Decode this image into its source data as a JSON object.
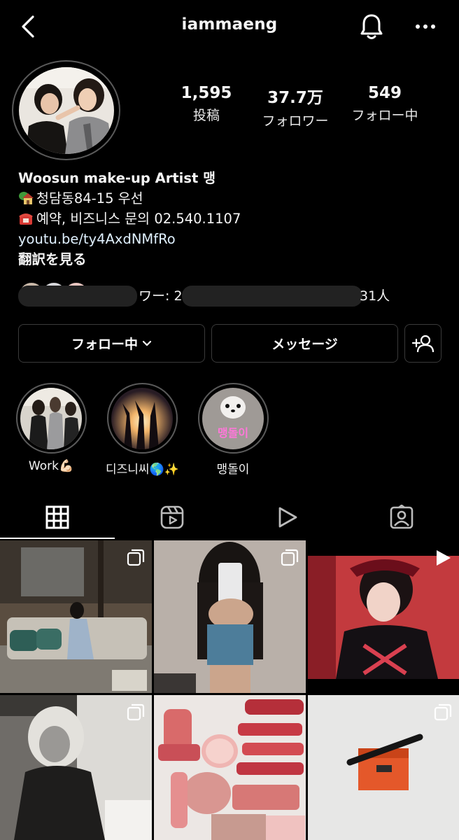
{
  "header": {
    "username": "iammaeng",
    "back_icon": "chevron-left-icon",
    "bell_icon": "bell-icon",
    "more_icon": "more-horizontal-icon"
  },
  "profile": {
    "stats": [
      {
        "value": "1,595",
        "label": "投稿"
      },
      {
        "value": "37.7万",
        "label": "フォロワー"
      },
      {
        "value": "549",
        "label": "フォロー中"
      }
    ],
    "bio": {
      "name": "Woosun make-up Artist 맹",
      "address": "청담동84-15 우선",
      "phone": "예약, 비즈니스 문의 02.540.1107",
      "link": "youtu.be/ty4AxdNMfRo",
      "translate": "翻訳を見る"
    },
    "followed_by": {
      "text_partial": "ワー: 2",
      "text_end": "31人"
    }
  },
  "actions": {
    "following_label": "フォロー中",
    "message_label": "メッセージ",
    "add_user_icon": "add-user-icon"
  },
  "highlights": [
    {
      "label": "Work💪🏻"
    },
    {
      "label": "디즈니씨🌎✨"
    },
    {
      "label": "맹돌이"
    }
  ],
  "highlight_text": {
    "doll_caption": "맹돌이"
  },
  "tabs": [
    {
      "icon": "grid-icon",
      "active": true
    },
    {
      "icon": "reels-icon",
      "active": false
    },
    {
      "icon": "play-icon",
      "active": false
    },
    {
      "icon": "tagged-icon",
      "active": false
    }
  ],
  "colors": {
    "background": "#000000",
    "border": "#3a3a3a",
    "link": "#e0f1ff"
  }
}
